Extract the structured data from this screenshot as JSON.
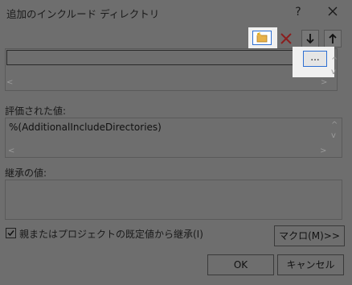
{
  "window": {
    "title": "追加のインクルード ディレクトリ",
    "help_label": "?",
    "close_icon": "close-icon"
  },
  "toolbar": {
    "icons": [
      "new-line-folder-icon",
      "delete-icon",
      "move-down-icon",
      "move-up-icon"
    ]
  },
  "directory_list": {
    "current_value": "",
    "browse_label": "..."
  },
  "evaluated": {
    "label": "評価された値:",
    "value": "%(AdditionalIncludeDirectories)"
  },
  "inherited": {
    "label": "継承の値:",
    "value": ""
  },
  "inherit_checkbox": {
    "label": "親またはプロジェクトの既定値から継承(I)",
    "checked": true
  },
  "buttons": {
    "macro": "マクロ(M)>>",
    "ok": "OK",
    "cancel": "キャンセル"
  },
  "colors": {
    "dim_background": "#6e6e6e",
    "highlight": "#f0f0f0",
    "focus_blue": "#2d6fd3",
    "delete_red": "#c0392b"
  }
}
